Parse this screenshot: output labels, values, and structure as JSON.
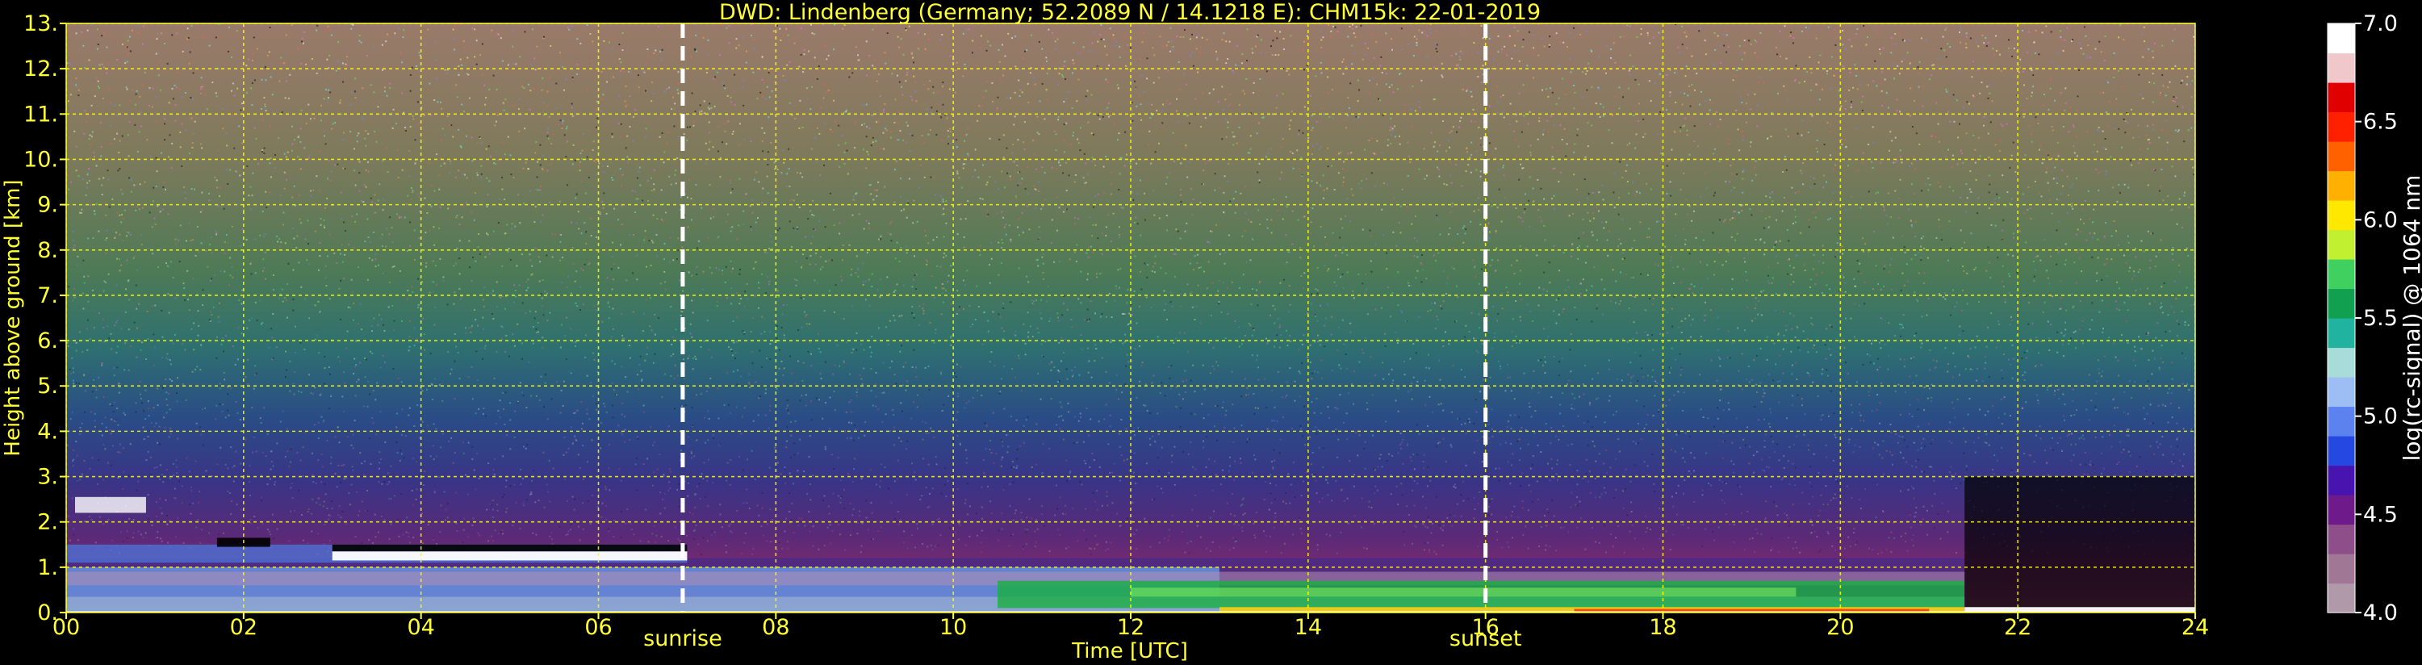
{
  "chart_data": {
    "type": "heatmap",
    "title": "DWD: Lindenberg (Germany; 52.2089 N / 14.1218 E):    CHM15k: 22-01-2019",
    "xlabel": "Time [UTC]",
    "ylabel": "Height above ground [km]",
    "xlim": [
      0,
      24
    ],
    "ylim": [
      0,
      13
    ],
    "x_ticks": [
      "00",
      "02",
      "04",
      "06",
      "08",
      "10",
      "12",
      "14",
      "16",
      "18",
      "20",
      "22",
      "24"
    ],
    "y_ticks": [
      "0.",
      "1.",
      "2.",
      "3.",
      "4.",
      "5.",
      "6.",
      "7.",
      "8.",
      "9.",
      "10.",
      "11.",
      "12.",
      "13."
    ],
    "grid": true,
    "grid_color": "#ffff00",
    "markers": [
      {
        "label": "sunrise",
        "x": 6.95
      },
      {
        "label": "sunset",
        "x": 16.0
      }
    ],
    "colorbar": {
      "label": "log(rc-signal) @ 1064 nm",
      "range": [
        4.0,
        7.0
      ],
      "ticks": [
        "4.0",
        "4.5",
        "5.0",
        "5.5",
        "6.0",
        "6.5",
        "7.0"
      ],
      "colors": [
        "#b09aaa",
        "#a07896",
        "#8e4e8a",
        "#6e1a8a",
        "#4814b0",
        "#2448e0",
        "#5c82f0",
        "#9cbef4",
        "#a8dcd8",
        "#20b4a0",
        "#10a050",
        "#40d060",
        "#c0f030",
        "#ffe800",
        "#ffb000",
        "#ff6000",
        "#ff2000",
        "#e00000",
        "#f0c8cc",
        "#ffffff"
      ]
    }
  }
}
